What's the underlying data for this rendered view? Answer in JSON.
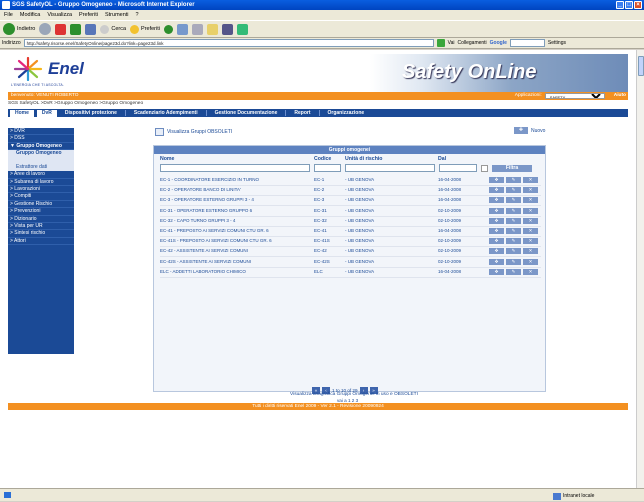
{
  "window": {
    "title": "SGS SafetyOL - Gruppo Omogeneo - Microsoft Internet Explorer"
  },
  "menu": [
    "File",
    "Modifica",
    "Visualizza",
    "Preferiti",
    "Strumenti",
    "?"
  ],
  "toolbar": {
    "back": "Indietro",
    "search": "Cerca",
    "favorites": "Preferiti",
    "go": "Vai",
    "links": "Collegamenti",
    "google": "Google",
    "settings": "Settings"
  },
  "address": {
    "label": "Indirizzo",
    "url": "http://safety.risorse.enel/SafetyOnline/page23d.do?link=page23d.link"
  },
  "status": {
    "zone": "Intranet locale"
  },
  "banner": {
    "logo_text": "Enel",
    "tagline": "L'ENERGIA CHE TI ASCOLTA.",
    "title": "Safety OnLine"
  },
  "welcome": {
    "text": "benvenuto: VENUTI ROBERTO",
    "app_label": "Applicazioni:",
    "app_value": "SAFETY",
    "help": "Aiuto"
  },
  "breadcrumb": "SGS SafetyOL >DvR >Gruppo Omogeneo >Gruppo Omogeneo",
  "nav": [
    "Home",
    "DvR",
    "Dispositivi protezione",
    "Scadenziario Adempimenti",
    "Gestione Documentazione",
    "Report",
    "Organizzazione"
  ],
  "sidebar": {
    "top": [
      "> DVR",
      "> DSS"
    ],
    "open": "▼ Gruppo Omogeneo",
    "sub1": "Gruppo Omogeneo",
    "sub2": "Estrattore dati",
    "rest": [
      "> Aree di lavoro",
      "> Subarea di lavoro",
      "> Lavorazioni",
      "> Compiti",
      "> Gestione Rischio",
      "> Prevenzioni",
      "> Dizionario",
      "> Vista per UR",
      "> Sintesi rischio",
      "> Attori"
    ]
  },
  "content": {
    "obsolete_link": "Visualizza Gruppi OBSOLETI",
    "new_label": "Nuovo",
    "panel_title": "Gruppi omogenei",
    "columns": {
      "name": "Nome",
      "code": "Codice",
      "unit": "Unità di rischio",
      "from": "Dal"
    },
    "filter": "Filtra",
    "rows": [
      {
        "name": "EC-1 - COORDINATORE ESERCIZIO IN TURNO",
        "code": "EC-1",
        "unit": "- UB GENOVA",
        "date": "16-04-2008"
      },
      {
        "name": "EC-2 - OPERATORE BANCO DI LINITA'",
        "code": "EC-2",
        "unit": "- UB GENOVA",
        "date": "16-04-2008"
      },
      {
        "name": "EC-3 - OPERATORE ESTERNO GRUPPI 3 - 4",
        "code": "EC-3",
        "unit": "- UB GENOVA",
        "date": "16-04-2008"
      },
      {
        "name": "EC-31 - OPERATORE ESTERNO GRUPPO 6",
        "code": "EC-31",
        "unit": "- UB GENOVA",
        "date": "02-10-2009"
      },
      {
        "name": "EC-32 - CAPO TURNO GRUPPI 3 - 4",
        "code": "EC-32",
        "unit": "- UB GENOVA",
        "date": "02-10-2009"
      },
      {
        "name": "EC-41 - PREPOSTO AI SERVIZI COMUNI CTU GR. 6",
        "code": "EC-41",
        "unit": "- UB GENOVA",
        "date": "16-04-2008"
      },
      {
        "name": "EC-41S - PREPOSTO AI SERVIZI COMUNI CTU GR. 6",
        "code": "EC-41S",
        "unit": "- UB GENOVA",
        "date": "02-10-2009"
      },
      {
        "name": "EC-42 - ASSISTENTE AI SERVIZI COMUNI",
        "code": "EC-42",
        "unit": "- UB GENOVA",
        "date": "02-10-2009"
      },
      {
        "name": "EC-42S - ASSISTENTE AI SERVIZI COMUNI",
        "code": "EC-42S",
        "unit": "- UB GENOVA",
        "date": "02-10-2009"
      },
      {
        "name": "ELC - ADDETTI LABORATORIO CHIMICO",
        "code": "ELC",
        "unit": "- UB GENOVA",
        "date": "16-04-2008"
      }
    ],
    "pager": "1 to 10 of 29",
    "goto": "vai a 1 2 3",
    "bottom_link": "Visualizza anagrafica Gruppi Omogenei in uso e OBSOLETI"
  },
  "footer": "Tutti i diritti riservati Enel 2009 - Ver 2.1 - Revisione 20090924"
}
